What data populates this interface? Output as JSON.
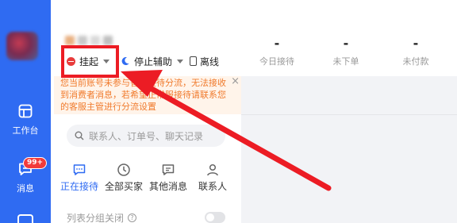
{
  "rail": {
    "items": [
      {
        "label": "工作台",
        "icon": "workbench-icon"
      },
      {
        "label": "消息",
        "icon": "message-icon",
        "badge": "99+"
      }
    ]
  },
  "header": {
    "status_hangup": "挂起",
    "status_assist": "停止辅助",
    "status_offline": "离线",
    "metrics": [
      {
        "value": "-",
        "label": "今日接待"
      },
      {
        "value": "-",
        "label": "未下单"
      },
      {
        "value": "-",
        "label": "未付款"
      }
    ]
  },
  "notice": {
    "text": "您当前账号未参与智能接待分流，无法接收到消费者消息，若希望正常服接待请联系您的客服主管进行分流设置",
    "close": "×"
  },
  "search": {
    "placeholder": "联系人、订单号、聊天记录"
  },
  "tabs": [
    {
      "label": "正在接待",
      "icon": "chat-icon",
      "active": true
    },
    {
      "label": "全部买家",
      "icon": "clock-icon",
      "active": false
    },
    {
      "label": "其他消息",
      "icon": "message-box-icon",
      "active": false
    },
    {
      "label": "联系人",
      "icon": "person-icon",
      "active": false
    }
  ],
  "group_toggle": {
    "label": "列表分组关闭",
    "help": "?",
    "enabled": false
  },
  "colors": {
    "rail": "#2f6bf2",
    "accent": "#2f6bf2",
    "notice_text": "#f07a2c",
    "annotation": "#ec1c24"
  }
}
